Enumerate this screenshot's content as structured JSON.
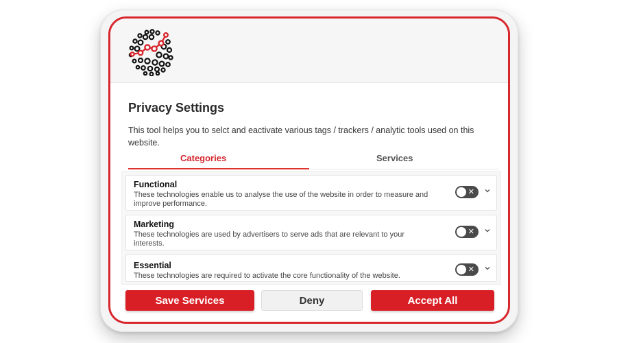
{
  "dialog": {
    "title": "Privacy Settings",
    "description": "This tool helps you to selct and eactivate various tags / trackers / analytic tools used on this website."
  },
  "logo": {
    "icon": "sphere-dots-logo",
    "colors": [
      "#111111",
      "#d7262c"
    ]
  },
  "tabs": [
    {
      "label": "Categories",
      "active": true
    },
    {
      "label": "Services",
      "active": false
    }
  ],
  "categories": [
    {
      "title": "Functional",
      "text": "These technologies enable us to analyse the use of the website in order to measure and improve performance.",
      "enabled": false,
      "toggle_glyph": "✕"
    },
    {
      "title": "Marketing",
      "text": "These technologies are used by advertisers to serve ads that are relevant to your interests.",
      "enabled": false,
      "toggle_glyph": "✕"
    },
    {
      "title": "Essential",
      "text": "These technologies are required to activate the core functionality of the website.",
      "enabled": false,
      "toggle_glyph": "✕"
    }
  ],
  "buttons": {
    "save": "Save Services",
    "deny": "Deny",
    "accept": "Accept All"
  },
  "colors": {
    "accent": "#d7262c",
    "toggle_off": "#4a4a4a"
  }
}
